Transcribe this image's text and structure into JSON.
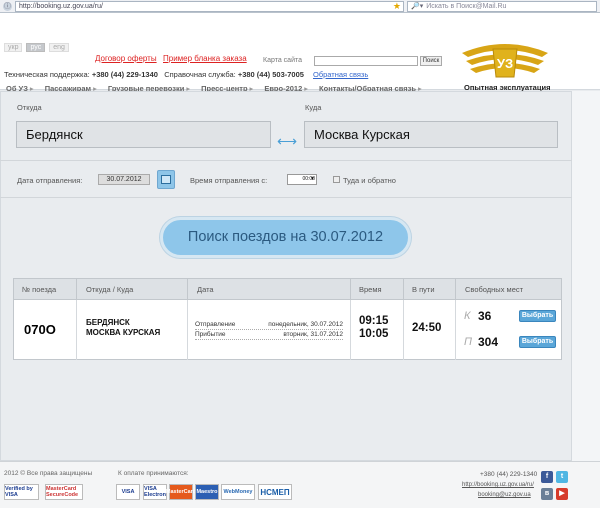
{
  "browser": {
    "url": "http://booking.uz.gov.ua/ru/",
    "search_placeholder": "Искать в Поиск@Mail.Ru"
  },
  "header": {
    "langs": [
      "укр",
      "рус",
      "eng"
    ],
    "contract_link": "Договор оферты",
    "order_sample_link": "Пример бланка заказа",
    "sitemap_label": "Карта сайта",
    "site_search_button": "Поиск",
    "support_label": "Техническая поддержка:",
    "support_phone": "+380 (44) 229-1340",
    "info_label": "Справочная служба:",
    "info_phone": "+380 (44) 503-7005",
    "feedback_link": "Обратная связь",
    "nav": [
      "Об УЗ",
      "Пассажирам",
      "Грузовые перевозки",
      "Пресс-центр",
      "Евро-2012",
      "Контакты/Обратная связь"
    ],
    "logo_caption": "Опытная эксплуатация"
  },
  "form": {
    "from_label": "Откуда",
    "from_value": "Бердянск",
    "to_label": "Куда",
    "to_value": "Москва Курская",
    "date_label": "Дата отправления:",
    "date_value": "30.07.2012",
    "time_label": "Время отправления с:",
    "time_value": "00:00",
    "roundtrip_label": "Туда и обратно",
    "search_button": "Поиск поездов на 30.07.2012"
  },
  "table": {
    "headers": [
      "№ поезда",
      "Откуда / Куда",
      "Дата",
      "Время",
      "В пути",
      "Свободных мест"
    ],
    "row": {
      "train": "070О",
      "from": "БЕРДЯНСК",
      "to": "МОСКВА КУРСКАЯ",
      "departure_label": "Отправление",
      "departure_date": "понедельник, 30.07.2012",
      "arrival_label": "Прибытие",
      "arrival_date": "вторник, 31.07.2012",
      "dep_time": "09:15",
      "arr_time": "10:05",
      "travel_time": "24:50",
      "seats": [
        {
          "class": "К",
          "count": "36",
          "button": "Выбрать"
        },
        {
          "class": "П",
          "count": "304",
          "button": "Выбрать"
        }
      ]
    }
  },
  "footer": {
    "copyright": "2012 © Все права защищены",
    "accept_label": "К оплате принимаются:",
    "phone": "+380 (44) 229-1340",
    "site_link": "http://booking.uz.gov.ua/ru/",
    "email_link": "booking@uz.gov.ua",
    "badges": [
      "Verified by VISA",
      "MasterCard SecureCode",
      "VISA",
      "VISA Electron",
      "MasterCard",
      "Maestro",
      "WebMoney",
      "НСМЕП"
    ]
  },
  "colors": {
    "accent": "#4a9fd6",
    "search_button": "#8ec6ea",
    "logo_gold": "#d8a516",
    "link_red": "#dd2222"
  }
}
